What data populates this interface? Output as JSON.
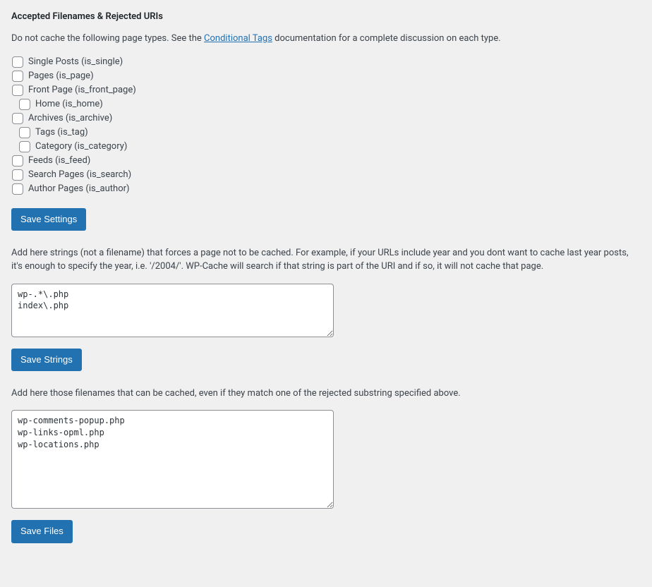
{
  "heading": "Accepted Filenames & Rejected URIs",
  "intro_prefix": "Do not cache the following page types. See the ",
  "intro_link": "Conditional Tags",
  "intro_suffix": " documentation for a complete discussion on each type.",
  "checks": {
    "single": "Single Posts (is_single)",
    "pages": "Pages (is_page)",
    "front": "Front Page (is_front_page)",
    "home": "Home (is_home)",
    "archives": "Archives (is_archive)",
    "tags": "Tags (is_tag)",
    "category": "Category (is_category)",
    "feeds": "Feeds (is_feed)",
    "search": "Search Pages (is_search)",
    "author": "Author Pages (is_author)"
  },
  "buttons": {
    "save_settings": "Save Settings",
    "save_strings": "Save Strings",
    "save_files": "Save Files"
  },
  "strings_instruction": "Add here strings (not a filename) that forces a page not to be cached. For example, if your URLs include year and you dont want to cache last year posts, it's enough to specify the year, i.e. '/2004/'. WP-Cache will search if that string is part of the URI and if so, it will not cache that page.",
  "strings_value": "wp-.*\\.php\nindex\\.php",
  "files_instruction": "Add here those filenames that can be cached, even if they match one of the rejected substring specified above.",
  "files_value": "wp-comments-popup.php\nwp-links-opml.php\nwp-locations.php"
}
